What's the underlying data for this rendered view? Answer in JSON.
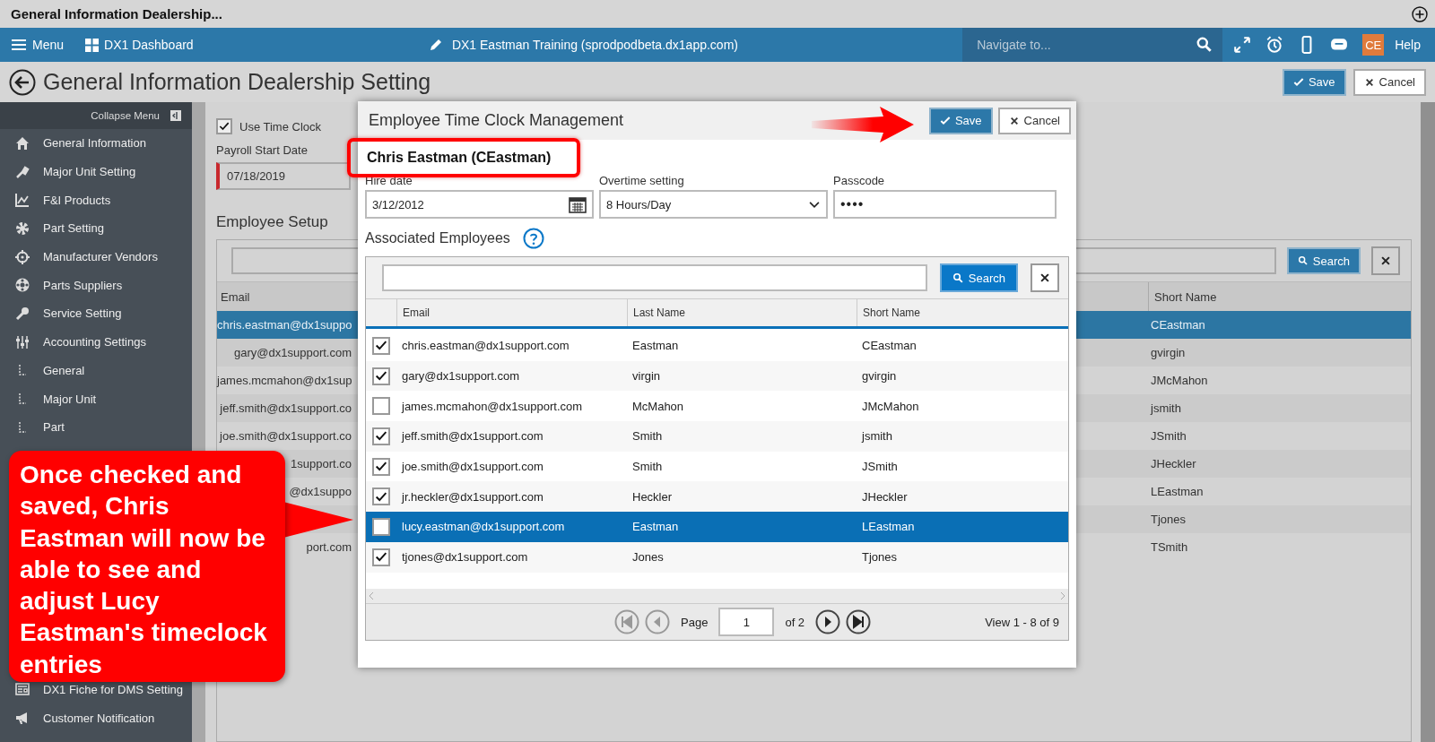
{
  "title_bar": {
    "title": "General Information Dealership..."
  },
  "nav": {
    "menu": "Menu",
    "dashboard": "DX1 Dashboard",
    "site": "DX1 Eastman Training (sprodpodbeta.dx1app.com)",
    "search_placeholder": "Navigate to...",
    "avatar": "CE",
    "help": "Help"
  },
  "page": {
    "title": "General Information Dealership Setting",
    "buttons": [
      {
        "label": "Save",
        "kind": "primary"
      },
      {
        "label": "Cancel",
        "kind": "secondary"
      }
    ]
  },
  "sidebar": {
    "collapse": "Collapse Menu",
    "items": [
      {
        "label": "General Information",
        "kind": "main"
      },
      {
        "label": "Major Unit Setting",
        "kind": "main"
      },
      {
        "label": "F&I Products",
        "kind": "main"
      },
      {
        "label": "Part Setting",
        "kind": "main"
      },
      {
        "label": "Manufacturer Vendors",
        "kind": "main"
      },
      {
        "label": "Parts Suppliers",
        "kind": "main"
      },
      {
        "label": "Service Setting",
        "kind": "main"
      },
      {
        "label": "Accounting Settings",
        "kind": "main"
      },
      {
        "label": "General",
        "kind": "sub"
      },
      {
        "label": "Major Unit",
        "kind": "sub"
      },
      {
        "label": "Part",
        "kind": "sub"
      }
    ],
    "lower_items": [
      {
        "label": "DX1 Fiche for DMS Setting",
        "kind": "main"
      },
      {
        "label": "Customer Notification",
        "kind": "main"
      }
    ]
  },
  "use_time_clock": {
    "label": "Use Time Clock",
    "checked": true
  },
  "payroll_start_date": {
    "label": "Payroll Start Date",
    "value": "07/18/2019"
  },
  "employee_setup": {
    "title": "Employee Setup",
    "search_button": "Search",
    "columns": [
      "Email",
      "Short Name"
    ],
    "rows": [
      {
        "email": "chris.eastman@dx1suppo",
        "short_name": "CEastman",
        "selected": true
      },
      {
        "email": "gary@dx1support.com",
        "short_name": "gvirgin",
        "selected": false
      },
      {
        "email": "james.mcmahon@dx1sup",
        "short_name": "JMcMahon",
        "selected": false
      },
      {
        "email": "jeff.smith@dx1support.co",
        "short_name": "jsmith",
        "selected": false
      },
      {
        "email": "joe.smith@dx1support.co",
        "short_name": "JSmith",
        "selected": false
      },
      {
        "email": "1support.co",
        "short_name": "JHeckler",
        "selected": false
      },
      {
        "email": "@dx1suppo",
        "short_name": "LEastman",
        "selected": false
      },
      {
        "short_name": "Tjones",
        "selected": false
      },
      {
        "email": "port.com",
        "short_name": "TSmith",
        "selected": false
      }
    ]
  },
  "modal": {
    "title": "Employee Time Clock Management",
    "buttons": [
      {
        "label": "Save",
        "kind": "primary"
      },
      {
        "label": "Cancel",
        "kind": "secondary"
      }
    ],
    "employee": "Chris Eastman (CEastman)",
    "hire_date": {
      "label": "Hire date",
      "value": "3/12/2012"
    },
    "overtime": {
      "label": "Overtime setting",
      "value": "8 Hours/Day"
    },
    "passcode": {
      "label": "Passcode",
      "value": "••••"
    },
    "associated": {
      "title": "Associated Employees",
      "search_button": "Search",
      "columns": [
        "Email",
        "Last Name",
        "Short Name"
      ],
      "rows": [
        {
          "email": "chris.eastman@dx1support.com",
          "last_name": "Eastman",
          "short_name": "CEastman",
          "checked": true,
          "selected": false
        },
        {
          "email": "gary@dx1support.com",
          "last_name": "virgin",
          "short_name": "gvirgin",
          "checked": true,
          "selected": false
        },
        {
          "email": "james.mcmahon@dx1support.com",
          "last_name": "McMahon",
          "short_name": "JMcMahon",
          "checked": false,
          "selected": false
        },
        {
          "email": "jeff.smith@dx1support.com",
          "last_name": "Smith",
          "short_name": "jsmith",
          "checked": true,
          "selected": false
        },
        {
          "email": "joe.smith@dx1support.com",
          "last_name": "Smith",
          "short_name": "JSmith",
          "checked": true,
          "selected": false
        },
        {
          "email": "jr.heckler@dx1support.com",
          "last_name": "Heckler",
          "short_name": "JHeckler",
          "checked": true,
          "selected": false
        },
        {
          "email": "lucy.eastman@dx1support.com",
          "last_name": "Eastman",
          "short_name": "LEastman",
          "checked": false,
          "selected": true
        },
        {
          "email": "tjones@dx1support.com",
          "last_name": "Jones",
          "short_name": "Tjones",
          "checked": true,
          "selected": false
        }
      ]
    },
    "pager": {
      "page_label": "Page",
      "page": "1",
      "of": "of 2",
      "view": "View 1 - 8 of 9"
    }
  },
  "callout": {
    "text": "Once checked and saved, Chris Eastman will now be able to see and adjust Lucy Eastman's timeclock entries"
  }
}
